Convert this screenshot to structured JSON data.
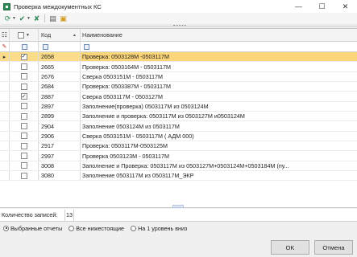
{
  "window": {
    "title": "Проверка междокументных КС",
    "minimize_glyph": "—",
    "maximize_glyph": "☐",
    "close_glyph": "✕"
  },
  "toolbar": {
    "icons": [
      "refresh-icon",
      "check-icon",
      "uncheck-icon",
      "print-icon",
      "export-icon"
    ]
  },
  "grid": {
    "columns": {
      "code": "Код",
      "name": "Наименование"
    },
    "rows": [
      {
        "checked": true,
        "code": "2658",
        "name": "Проверка: 0503128М -0503117М",
        "selected": true
      },
      {
        "checked": false,
        "code": "2665",
        "name": "Проверка: 0503164М - 0503117М",
        "selected": false
      },
      {
        "checked": false,
        "code": "2676",
        "name": "Сверка 0503151М - 0503117М",
        "selected": false
      },
      {
        "checked": false,
        "code": "2684",
        "name": "Проверка: 0503387М - 0503117М",
        "selected": false
      },
      {
        "checked": true,
        "code": "2887",
        "name": "Сверка 0503117М - 0503127М",
        "selected": false
      },
      {
        "checked": false,
        "code": "2897",
        "name": "Заполнение(проверка) 0503117М из 0503124М",
        "selected": false
      },
      {
        "checked": false,
        "code": "2899",
        "name": "Заполнение и проверка: 0503117М из 0503127М и0503124М",
        "selected": false
      },
      {
        "checked": false,
        "code": "2904",
        "name": "Заполнение 0503124М из 0503117М",
        "selected": false
      },
      {
        "checked": false,
        "code": "2906",
        "name": "Сверка 0503151М - 0503117М ( АДМ 000)",
        "selected": false
      },
      {
        "checked": false,
        "code": "2917",
        "name": "Проверка: 0503117М-0503125М",
        "selected": false
      },
      {
        "checked": false,
        "code": "2997",
        "name": "Проверка 0503123М - 0503117М",
        "selected": false
      },
      {
        "checked": false,
        "code": "3008",
        "name": "Заполнение и Проверка: 0503117М из 0503127М+0503124М+0503184М (пу...",
        "selected": false
      },
      {
        "checked": false,
        "code": "3080",
        "name": "Заполнение 0503117М из 0503117М_ЭКР",
        "selected": false
      }
    ]
  },
  "footer": {
    "count_label": "Количество записей:",
    "count_value": "13",
    "radio_options": [
      {
        "label": "Выбранные отчеты",
        "checked": true
      },
      {
        "label": "Все нижестоящие",
        "checked": false
      },
      {
        "label": "На 1 уровень вниз",
        "checked": false
      }
    ],
    "ok_label": "OK",
    "cancel_label": "Отмена"
  }
}
